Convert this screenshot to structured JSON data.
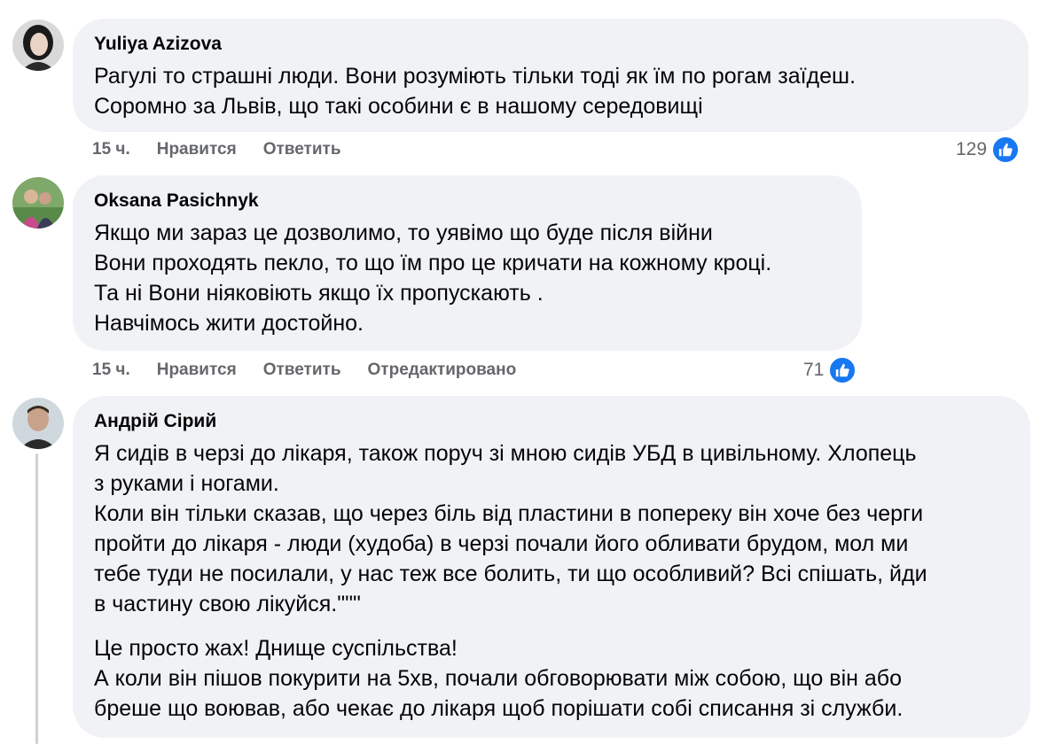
{
  "comments": [
    {
      "author": "Yuliya Azizova",
      "lines": [
        "Рагулі то страшні люди. Вони розуміють тільки тоді як їм по рогам заїдеш.",
        "Соромно за Львів, що такі особини є в нашому середовищі"
      ],
      "time": "15 ч.",
      "like_action": "Нравится",
      "reply_action": "Ответить",
      "reaction_count": "129",
      "reaction_icon": "like-icon"
    },
    {
      "author": "Oksana Pasichnyk",
      "lines": [
        "Якщо ми зараз це дозволимо, то уявімо що буде після війни",
        "Вони проходять пекло, то що їм про це кричати на кожному кроці.",
        "Та ні Вони ніяковіють якщо їх пропускають .",
        "Навчімось жити достойно."
      ],
      "time": "15 ч.",
      "like_action": "Нравится",
      "reply_action": "Ответить",
      "edited_label": "Отредактировано",
      "reaction_count": "71",
      "reaction_icon": "like-icon"
    },
    {
      "author": "Андрій Сірий",
      "paragraph1": [
        "Я сидів в черзі до лікаря, також поруч зі мною сидів УБД в цивільному. Хлопець",
        "з руками і ногами.",
        "Коли він тільки сказав, що через біль від пластини в попереку він хоче без черги",
        "пройти до лікаря - люди (худоба) в черзі почали його обливати брудом, мол ми",
        "тебе туди не посилали, у нас теж все болить, ти що особливий? Всі спішать, йди",
        "в частину свою лікуйся.\"\"\""
      ],
      "paragraph2": [
        "Це просто жах! Днище суспільства!",
        "А коли він пішов покурити на 5хв, почали обговорювати між собою, що він або",
        "бреше що воював, або чекає до лікаря щоб порішати собі списання зі служби."
      ]
    }
  ],
  "colors": {
    "bubble": "#f0f2f5",
    "secondary_text": "#65676b",
    "like_blue": "#1877f2"
  }
}
